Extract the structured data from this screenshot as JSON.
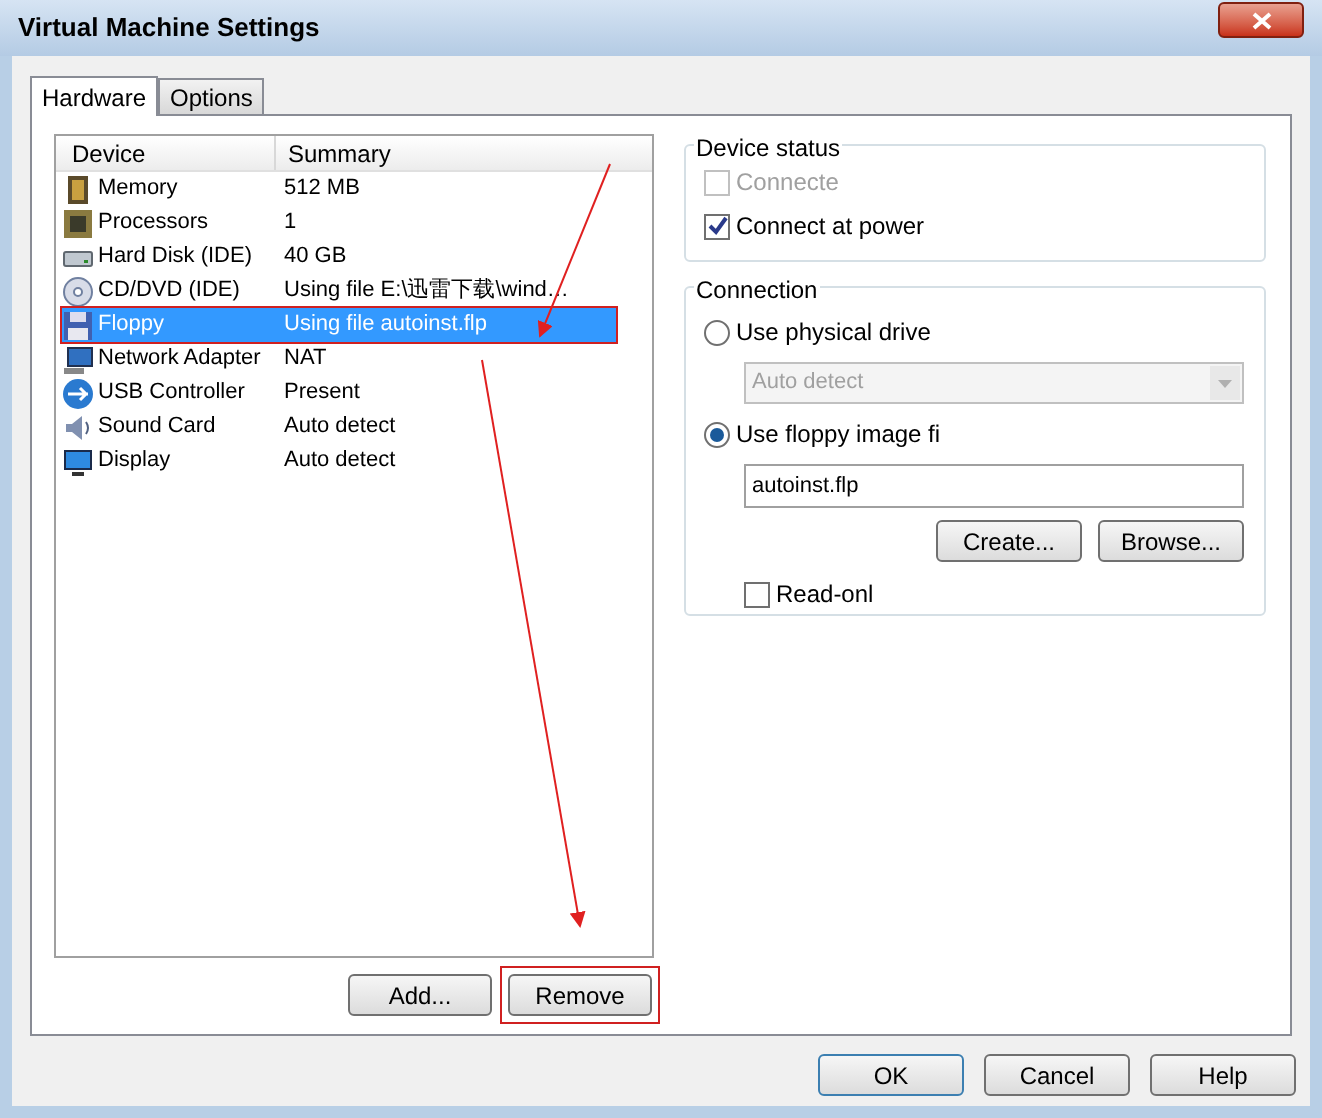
{
  "window": {
    "title": "Virtual Machine Settings"
  },
  "tabs": [
    {
      "label": "Hardware",
      "selected": true
    },
    {
      "label": "Options",
      "selected": false
    }
  ],
  "device_list": {
    "columns": [
      "Device",
      "Summary"
    ],
    "rows": [
      {
        "kind": "memory",
        "device": "Memory",
        "summary": "512 MB",
        "selected": false,
        "highlighted": false
      },
      {
        "kind": "processor",
        "device": "Processors",
        "summary": "1",
        "selected": false,
        "highlighted": false
      },
      {
        "kind": "disk",
        "device": "Hard Disk (IDE)",
        "summary": "40 GB",
        "selected": false,
        "highlighted": false
      },
      {
        "kind": "cd",
        "device": "CD/DVD (IDE)",
        "summary": "Using file E:\\迅雷下载\\wind…",
        "selected": false,
        "highlighted": false
      },
      {
        "kind": "floppy",
        "device": "Floppy",
        "summary": "Using file autoinst.flp",
        "selected": true,
        "highlighted": true
      },
      {
        "kind": "network",
        "device": "Network Adapter",
        "summary": "NAT",
        "selected": false,
        "highlighted": false
      },
      {
        "kind": "usb",
        "device": "USB Controller",
        "summary": "Present",
        "selected": false,
        "highlighted": false
      },
      {
        "kind": "sound",
        "device": "Sound Card",
        "summary": "Auto detect",
        "selected": false,
        "highlighted": false
      },
      {
        "kind": "display",
        "device": "Display",
        "summary": "Auto detect",
        "selected": false,
        "highlighted": false
      }
    ]
  },
  "list_buttons": [
    {
      "label": "Add...",
      "highlighted": false
    },
    {
      "label": "Remove",
      "highlighted": true
    }
  ],
  "device_status": {
    "title": "Device status",
    "options": [
      {
        "label": "Connecte",
        "checked": false,
        "disabled": true
      },
      {
        "label": "Connect at power",
        "checked": true,
        "disabled": false
      }
    ]
  },
  "connection": {
    "title": "Connection",
    "physical": {
      "label": "Use physical drive",
      "selected": false
    },
    "drive_select": {
      "value": "Auto detect",
      "disabled": true
    },
    "image": {
      "label": "Use floppy image fi",
      "selected": true
    },
    "image_path": {
      "value": "autoinst.flp"
    },
    "buttons": [
      "Create...",
      "Browse..."
    ],
    "read_only": {
      "label": "Read-onl",
      "checked": false
    }
  },
  "footer_buttons": [
    {
      "label": "OK",
      "default": true
    },
    {
      "label": "Cancel",
      "default": false
    },
    {
      "label": "Help",
      "default": false
    }
  ]
}
